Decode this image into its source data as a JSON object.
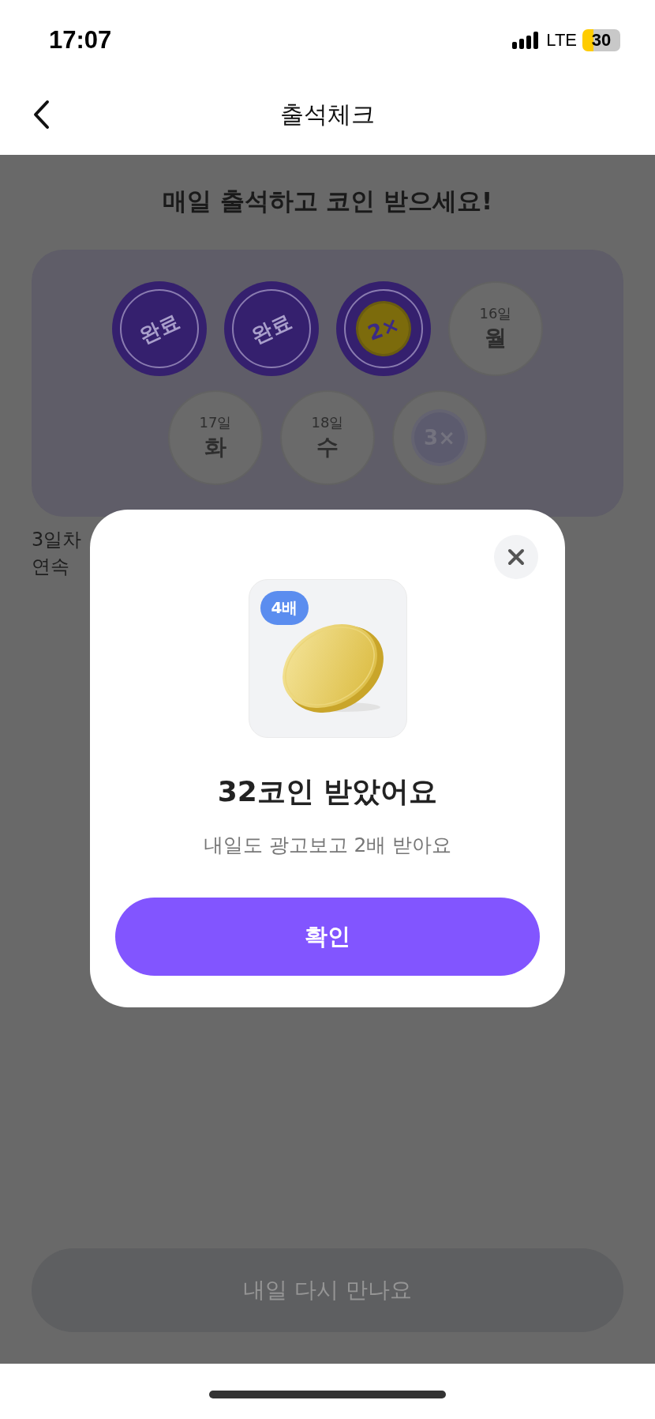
{
  "status_bar": {
    "time": "17:07",
    "network": "LTE",
    "battery": "30"
  },
  "nav": {
    "title": "출석체크"
  },
  "heading": "매일 출석하고 코인 받으세요!",
  "days": [
    {
      "kind": "done",
      "label": "완료"
    },
    {
      "kind": "done",
      "label": "완료"
    },
    {
      "kind": "bonus",
      "label": "2×",
      "reached": true
    },
    {
      "kind": "day",
      "date": "16일",
      "weekday": "월"
    },
    {
      "kind": "day",
      "date": "17일",
      "weekday": "화"
    },
    {
      "kind": "day",
      "date": "18일",
      "weekday": "수"
    },
    {
      "kind": "bonus",
      "label": "3×",
      "reached": false
    }
  ],
  "note_lines": [
    "3일차",
    "연속"
  ],
  "bottom_button": {
    "label": "내일 다시 만나요",
    "disabled": true
  },
  "dialog": {
    "badge": "4배",
    "title": "32코인 받았어요",
    "subtitle": "내일도 광고보고 2배 받아요",
    "confirm": "확인"
  }
}
